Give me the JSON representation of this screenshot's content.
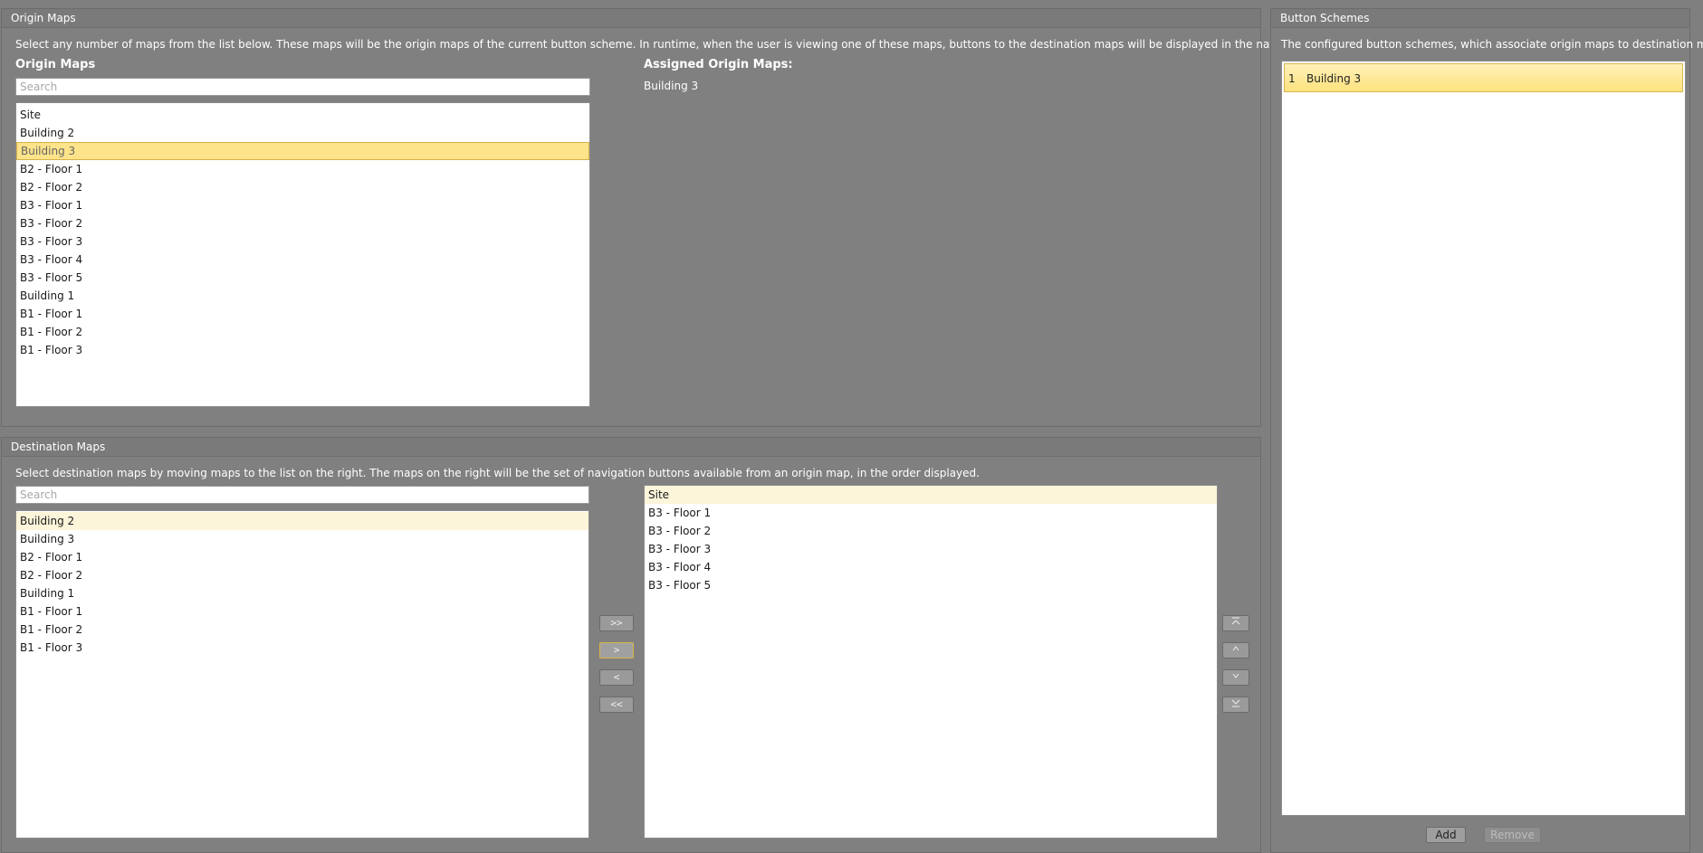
{
  "origin_panel": {
    "title": "Origin Maps",
    "description": "Select any number of maps from the list below. These maps will be the origin maps of the current button scheme. In runtime, when the user is viewing one of these maps, buttons to the destination maps will be displayed in the navigation item.",
    "list_label": "Origin Maps",
    "search_placeholder": "Search",
    "items": [
      "Site",
      "Building 2",
      "Building 3",
      "B2 - Floor 1",
      "B2 - Floor 2",
      "B3 - Floor 1",
      "B3 - Floor 2",
      "B3 - Floor 3",
      "B3 - Floor 4",
      "B3 - Floor 5",
      "Building 1",
      "B1 - Floor 1",
      "B1 - Floor 2",
      "B1 - Floor 3"
    ],
    "selected_item": "Building 3",
    "assigned_label": "Assigned Origin Maps:",
    "assigned_value": "Building 3"
  },
  "destination_panel": {
    "title": "Destination Maps",
    "description": "Select destination maps by moving maps to the list on the right. The maps on the right will be the set of navigation buttons available from an origin map, in the order displayed.",
    "search_placeholder": "Search",
    "available_items": [
      "Building 2",
      "Building 3",
      "B2 - Floor 1",
      "B2 - Floor 2",
      "Building 1",
      "B1 - Floor 1",
      "B1 - Floor 2",
      "B1 - Floor 3"
    ],
    "selected_items": [
      "Site",
      "B3 - Floor 1",
      "B3 - Floor 2",
      "B3 - Floor 3",
      "B3 - Floor 4",
      "B3 - Floor 5"
    ],
    "move_buttons": {
      "move_all_right": ">>",
      "move_right": ">",
      "move_left": "<",
      "move_all_left": "<<"
    },
    "order_buttons": {
      "move_top": "move-to-top-icon",
      "move_up": "move-up-icon",
      "move_down": "move-down-icon",
      "move_bottom": "move-to-bottom-icon"
    }
  },
  "schemes_panel": {
    "title": "Button Schemes",
    "description": "The configured button schemes, which associate origin maps to destination maps.",
    "schemes": [
      {
        "index": "1",
        "name": "Building 3"
      }
    ],
    "add_label": "Add",
    "remove_label": "Remove"
  },
  "colors": {
    "background": "#808080",
    "selection": "#fde48a",
    "hover": "#fdf5da",
    "focus_border": "#d9b547"
  }
}
